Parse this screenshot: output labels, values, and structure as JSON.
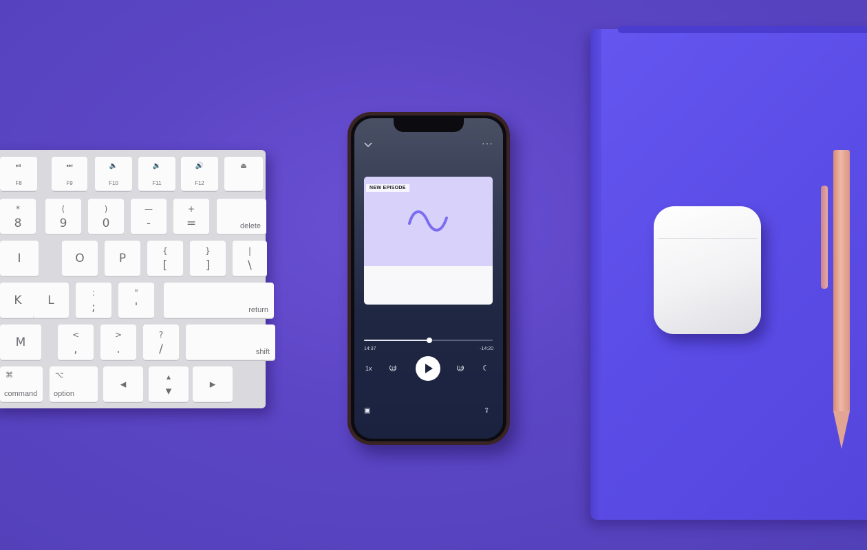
{
  "keyboard": {
    "rows": [
      [
        {
          "fn": "F8",
          "icon": "⏯"
        },
        {
          "fn": "F9",
          "icon": "⏭"
        },
        {
          "fn": "F10",
          "icon": "🔈"
        },
        {
          "fn": "F11",
          "icon": "🔉"
        },
        {
          "fn": "F12",
          "icon": "🔊"
        },
        {
          "fn": "",
          "icon": "⏏"
        }
      ],
      [
        {
          "top": "*",
          "bot": "8"
        },
        {
          "top": "(",
          "bot": "9"
        },
        {
          "top": ")",
          "bot": "0"
        },
        {
          "top": "—",
          "bot": "-"
        },
        {
          "top": "+",
          "bot": "="
        },
        {
          "wide": "delete"
        }
      ],
      [
        {
          "mid": "I"
        },
        {
          "mid": "O"
        },
        {
          "mid": "P"
        },
        {
          "top": "{",
          "bot": "["
        },
        {
          "top": "}",
          "bot": "]"
        },
        {
          "top": "|",
          "bot": "\\"
        }
      ],
      [
        {
          "mid": "K"
        },
        {
          "mid": "L"
        },
        {
          "top": ":",
          "bot": ";"
        },
        {
          "top": "\"",
          "bot": "'"
        },
        {
          "wide": "return"
        }
      ],
      [
        {
          "mid": "M"
        },
        {
          "top": "<",
          "bot": ","
        },
        {
          "top": ">",
          "bot": "."
        },
        {
          "top": "?",
          "bot": "/"
        },
        {
          "wide": "shift"
        }
      ],
      [
        {
          "sym": "⌘",
          "wideL": "command"
        },
        {
          "sym": "⌥",
          "wideL": "option"
        },
        {
          "mid": "◂"
        },
        {
          "top": "▴",
          "bot": "▾"
        },
        {
          "mid": "▸"
        }
      ]
    ]
  },
  "phone": {
    "collapse_icon": "chevron-down-icon",
    "more_icon": "more-icon",
    "badge": "NEW EPISODE",
    "elapsed": "14:37",
    "remaining": "-14:20",
    "progress": 0.51,
    "speed": "1x",
    "skip_back": "15",
    "skip_forward": "15",
    "colors": {
      "accent": "#7b6cf0",
      "artwork": "#d8d2fb"
    }
  }
}
